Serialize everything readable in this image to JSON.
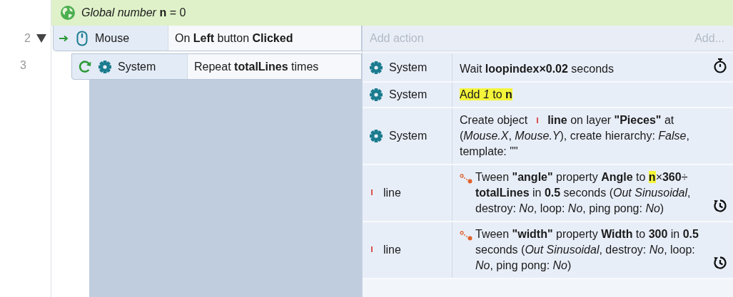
{
  "global_variable": {
    "text": "*Global number* **n** = 0"
  },
  "events": [
    {
      "line_number": "2",
      "expanded": true,
      "conditions": [
        {
          "kind": "mouse",
          "object": "Mouse",
          "trigger": true,
          "text": "On **Left** button **Clicked**"
        }
      ],
      "add_action": {
        "placeholder": "Add action",
        "button": "Add..."
      },
      "sub_events": [
        {
          "line_number": "3",
          "conditions": [
            {
              "kind": "system",
              "object": "System",
              "loop": true,
              "text": "Repeat **totalLines** times"
            }
          ],
          "actions": [
            {
              "kind": "system",
              "object": "System",
              "segments": [
                {
                  "kind": "text",
                  "text": "Wait **loopindex×0.02** seconds",
                  "highlighted": false
                },
                {
                  "kind": "timer"
                }
              ]
            },
            {
              "kind": "system",
              "object": "System",
              "segments": [
                {
                  "kind": "text",
                  "text": "Add *1* to **n**",
                  "highlighted": true
                }
              ]
            },
            {
              "kind": "system",
              "object": "System",
              "segments": [
                {
                  "kind": "text",
                  "text": "Create object",
                  "highlighted": false,
                  "inline": true
                },
                {
                  "kind": "object"
                },
                {
                  "kind": "text",
                  "text": "**line** on layer **\"Pieces\"** at",
                  "highlighted": false,
                  "inline": true
                },
                {
                  "kind": "text",
                  "text": "(*Mouse.X*, *Mouse.Y*), create hierarchy: *False*, template: \"\"",
                  "highlighted": false
                }
              ]
            },
            {
              "kind": "line",
              "object": "line",
              "segments": [
                {
                  "kind": "tween"
                },
                {
                  "kind": "text",
                  "text": "Tween **\"angle\"** property **Angle** to ",
                  "highlighted": false
                },
                {
                  "kind": "text",
                  "text": "**n**",
                  "highlighted": true
                },
                {
                  "kind": "text",
                  "text": "×**360**÷ **totalLines** in **0.5** seconds (*Out Sinusoidal*, destroy: *No*, loop: *No*, ping pong: *No*)",
                  "highlighted": false
                },
                {
                  "kind": "repeat"
                }
              ]
            },
            {
              "kind": "line",
              "object": "line",
              "segments": [
                {
                  "kind": "tween"
                },
                {
                  "kind": "text",
                  "text": "Tween **\"width\"** property **Width** to **300** in **0.5** seconds (*Out Sinusoidal*, destroy: *No*, loop: *No*, ping pong: *No*)",
                  "highlighted": false
                },
                {
                  "kind": "repeat"
                }
              ]
            }
          ]
        }
      ]
    }
  ]
}
